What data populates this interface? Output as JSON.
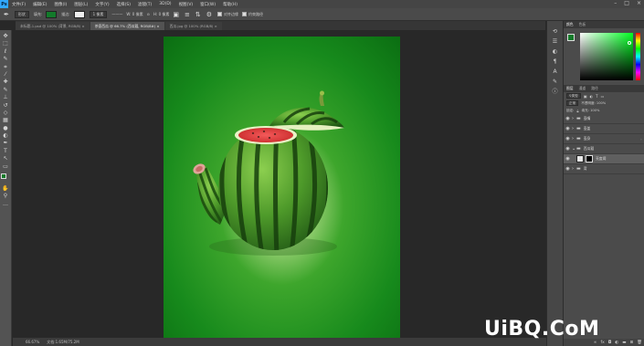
{
  "app": {
    "logo": "Ps"
  },
  "menu": [
    "文件(F)",
    "编辑(E)",
    "图像(I)",
    "图层(L)",
    "文字(Y)",
    "选择(S)",
    "滤镜(T)",
    "3D(D)",
    "视图(V)",
    "窗口(W)",
    "帮助(H)"
  ],
  "window_buttons": [
    "–",
    "□",
    "×"
  ],
  "options": {
    "tool_icon": "pen-icon",
    "mode": "形状",
    "fill_label": "填充:",
    "fill_color": "#137a2a",
    "stroke_label": "描边:",
    "stroke_width": "1 像素",
    "w_label": "W: 0 像素",
    "h_label": "H: 0 像素",
    "align_edges_label": "对齐边缘",
    "constrain_label": "约束路径"
  },
  "tabs": [
    {
      "label": "未标题-1.psd @ 100% (背景, RGB/8) ×",
      "active": false
    },
    {
      "label": "茶壶西瓜 @ 66.7% (西瓜瓤, RGB/8#) ×",
      "active": true
    },
    {
      "label": "西瓜.jpg @ 100% (RGB/8) ×",
      "active": false
    }
  ],
  "tools": [
    "move-icon",
    "marquee-icon",
    "lasso-icon",
    "quick-select-icon",
    "crop-icon",
    "eyedropper-icon",
    "healing-icon",
    "brush-icon",
    "stamp-icon",
    "history-brush-icon",
    "eraser-icon",
    "gradient-icon",
    "blur-icon",
    "dodge-icon",
    "pen-icon",
    "type-icon",
    "path-select-icon",
    "shape-icon",
    "hand-icon",
    "zoom-icon",
    "more-icon"
  ],
  "tool_glyphs": [
    "✥",
    "⬚",
    "ℓ",
    "✎",
    "⌗",
    "⁄",
    "✚",
    "✎",
    "⊥",
    "↺",
    "◇",
    "▦",
    "●",
    "◐",
    "✒",
    "T",
    "↖",
    "▭",
    "✋",
    "⚲",
    "…"
  ],
  "colors": {
    "foreground": "#137a2a",
    "background": "#0c0c0c",
    "accent": "#31a8ff"
  },
  "status": {
    "zoom": "66.67%",
    "doc_info": "文档:1.65M/75.2M"
  },
  "panel_icons": [
    "history-icon",
    "properties-icon",
    "adjust-icon",
    "paragraph-icon",
    "character-icon",
    "brush-settings-icon",
    "info-icon"
  ],
  "color_panel": {
    "tabs": [
      "颜色",
      "色板"
    ],
    "picker_color": "#14c324"
  },
  "layers_panel": {
    "tabs": [
      "图层",
      "通道",
      "路径"
    ],
    "kind_label": "类型",
    "blend_mode": "正常",
    "opacity_label": "不透明度: 100%",
    "lock_label": "锁定:",
    "fill_label": "填充: 100%",
    "layers": [
      {
        "name": "壶嘴",
        "type": "group",
        "selected": false
      },
      {
        "name": "壶盖",
        "type": "group",
        "selected": false
      },
      {
        "name": "壶身",
        "type": "group",
        "selected": false
      },
      {
        "name": "西瓜瓤",
        "type": "group",
        "selected": false
      },
      {
        "name": "亮度阈",
        "type": "masked",
        "selected": true
      },
      {
        "name": "背",
        "type": "group",
        "selected": false
      }
    ],
    "footer_icons": [
      "link-icon",
      "fx-icon",
      "mask-icon",
      "adjustment-icon",
      "folder-icon",
      "new-layer-icon",
      "trash-icon"
    ]
  },
  "watermark": "UiBQ.CoM"
}
